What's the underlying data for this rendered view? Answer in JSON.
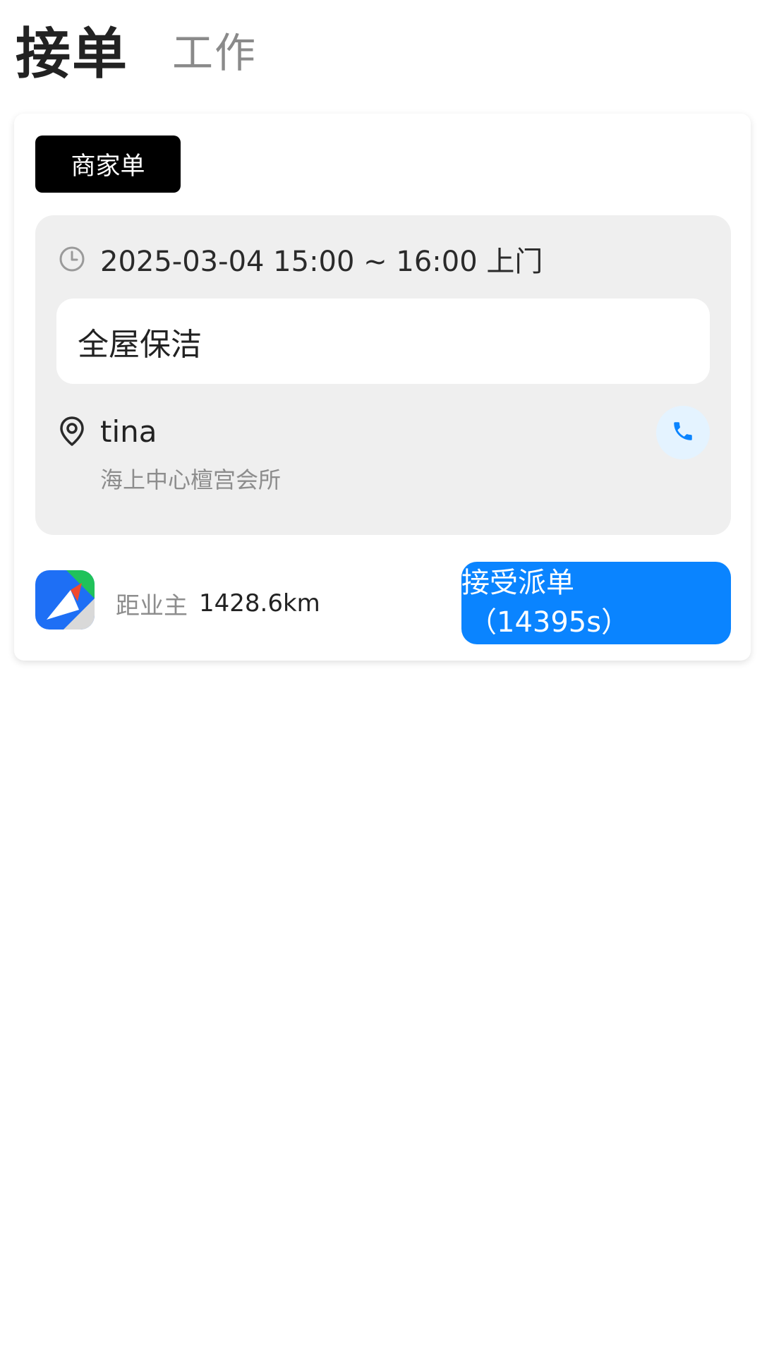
{
  "header": {
    "tabs": [
      {
        "label": "接单",
        "active": true
      },
      {
        "label": "工作",
        "active": false
      }
    ]
  },
  "order": {
    "badge": "商家单",
    "time": "2025-03-04 15:00 ~ 16:00 上门",
    "service": "全屋保洁",
    "customer_name": "tina",
    "address": "海上中心檀宫会所",
    "distance_label": "距业主",
    "distance_value": "1428.6km",
    "accept_label": "接受派单",
    "accept_countdown": "（14395s）"
  },
  "icons": {
    "clock": "clock-icon",
    "pin": "location-pin-icon",
    "phone": "phone-icon",
    "logo": "navigation-app-logo"
  },
  "colors": {
    "accent": "#0a84ff",
    "badge_bg": "#000000",
    "info_bg": "#efefef",
    "phone_bg": "#e4f3ff"
  }
}
